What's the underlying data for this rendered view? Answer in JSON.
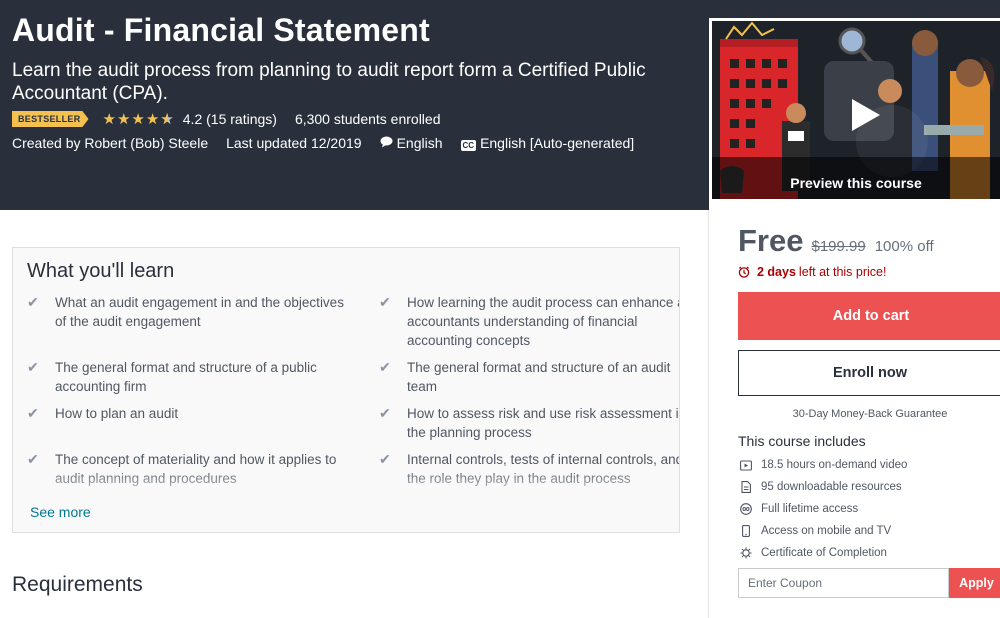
{
  "course": {
    "title": "Audit - Financial Statement",
    "subtitle": "Learn the audit process from planning to audit report form a Certified Public Accountant (CPA).",
    "badge": "BESTSELLER",
    "rating_value": 4.2,
    "rating_text": "4.2 (15 ratings)",
    "students": "6,300 students enrolled",
    "created_by": "Created by Robert (Bob) Steele",
    "last_updated": "Last updated 12/2019",
    "language": "English",
    "captions": "English [Auto-generated]"
  },
  "learn": {
    "title": "What you'll learn",
    "items": [
      "What an audit engagement in and the objectives of the audit engagement",
      "How learning the audit process can enhance an accountants understanding of financial accounting concepts",
      "The general format and structure of a public accounting firm",
      "The general format and structure of an audit team",
      "How to plan an audit",
      "How to assess risk and use risk assessment in the planning process",
      "The concept of materiality and how it applies to audit planning and procedures",
      "Internal controls, tests of internal controls, and the role they play in the audit process"
    ],
    "see_more": "See more"
  },
  "requirements": {
    "title": "Requirements"
  },
  "sidebar": {
    "preview_label": "Preview this course",
    "price": "Free",
    "old_price": "$199.99",
    "discount": "100% off",
    "timer_days": "2 days",
    "timer_rest": "left at this price!",
    "add_to_cart": "Add to cart",
    "enroll_now": "Enroll now",
    "guarantee": "30-Day Money-Back Guarantee",
    "includes_title": "This course includes",
    "includes": [
      {
        "icon": "video-icon",
        "text": "18.5 hours on-demand video"
      },
      {
        "icon": "file-icon",
        "text": "95 downloadable resources"
      },
      {
        "icon": "infinity-icon",
        "text": "Full lifetime access"
      },
      {
        "icon": "mobile-icon",
        "text": "Access on mobile and TV"
      },
      {
        "icon": "certificate-icon",
        "text": "Certificate of Completion"
      }
    ],
    "coupon_placeholder": "Enter Coupon",
    "apply": "Apply"
  },
  "colors": {
    "hero_bg": "#29303b",
    "accent_red": "#ec5252",
    "star": "#f4c150",
    "badge": "#f4c150",
    "link": "#007791",
    "timer": "#aa0000"
  }
}
